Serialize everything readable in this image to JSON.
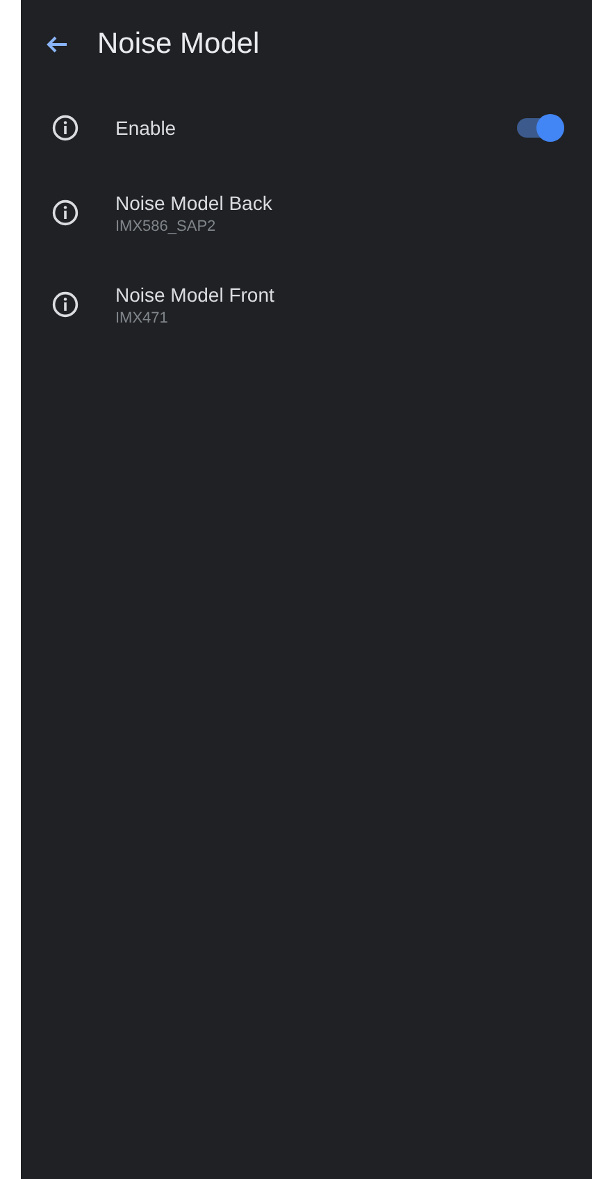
{
  "app_bar": {
    "title": "Noise Model"
  },
  "items": [
    {
      "kind": "switch",
      "title": "Enable",
      "on": true
    },
    {
      "kind": "text",
      "title": "Noise Model Back",
      "summary": "IMX586_SAP2"
    },
    {
      "kind": "text",
      "title": "Noise Model Front",
      "summary": "IMX471"
    }
  ]
}
